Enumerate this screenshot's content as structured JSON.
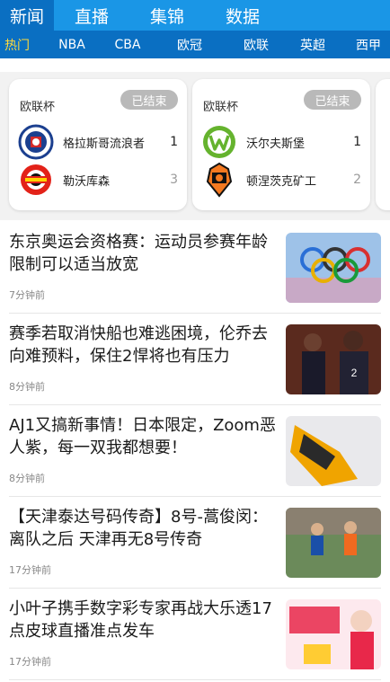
{
  "top_nav": {
    "tabs": [
      {
        "label": "新闻",
        "active": true
      },
      {
        "label": "直播",
        "active": false
      },
      {
        "label": "集锦",
        "active": false
      },
      {
        "label": "数据",
        "active": false
      }
    ]
  },
  "sub_nav": {
    "items": [
      {
        "label": "热门",
        "active": true
      },
      {
        "label": "NBA",
        "active": false
      },
      {
        "label": "CBA",
        "active": false
      },
      {
        "label": "欧冠",
        "active": false
      },
      {
        "label": "欧联",
        "active": false
      },
      {
        "label": "英超",
        "active": false
      },
      {
        "label": "西甲",
        "active": false
      }
    ]
  },
  "matches": [
    {
      "league": "欧联杯",
      "status": "已结束",
      "home": {
        "name": "格拉斯哥流浪者",
        "score": "1",
        "logo_icon": "rangers-crest-icon"
      },
      "away": {
        "name": "勒沃库森",
        "score": "3",
        "logo_icon": "leverkusen-crest-icon"
      }
    },
    {
      "league": "欧联杯",
      "status": "已结束",
      "home": {
        "name": "沃尔夫斯堡",
        "score": "1",
        "logo_icon": "wolfsburg-crest-icon"
      },
      "away": {
        "name": "顿涅茨克矿工",
        "score": "2",
        "logo_icon": "shakhtar-crest-icon"
      }
    }
  ],
  "news": [
    {
      "title": "东京奥运会资格赛：运动员参赛年龄限制可以适当放宽",
      "time": "7分钟前",
      "thumb_icon": "olympic-rings-image"
    },
    {
      "title": "赛季若取消快船也难逃困境，伦乔去向难预料，保住2悍将也有压力",
      "time": "8分钟前",
      "thumb_icon": "basketball-players-image"
    },
    {
      "title": "AJ1又搞新事情！日本限定，Zoom恶人紫，每一双我都想要！",
      "time": "8分钟前",
      "thumb_icon": "sneaker-image"
    },
    {
      "title": "【天津泰达号码传奇】8号-蒿俊闵：离队之后 天津再无8号传奇",
      "time": "17分钟前",
      "thumb_icon": "football-players-image"
    },
    {
      "title": "小叶子携手数字彩专家再战大乐透17点皮球直播准点发车",
      "time": "17分钟前",
      "thumb_icon": "lottery-promo-image"
    }
  ]
}
